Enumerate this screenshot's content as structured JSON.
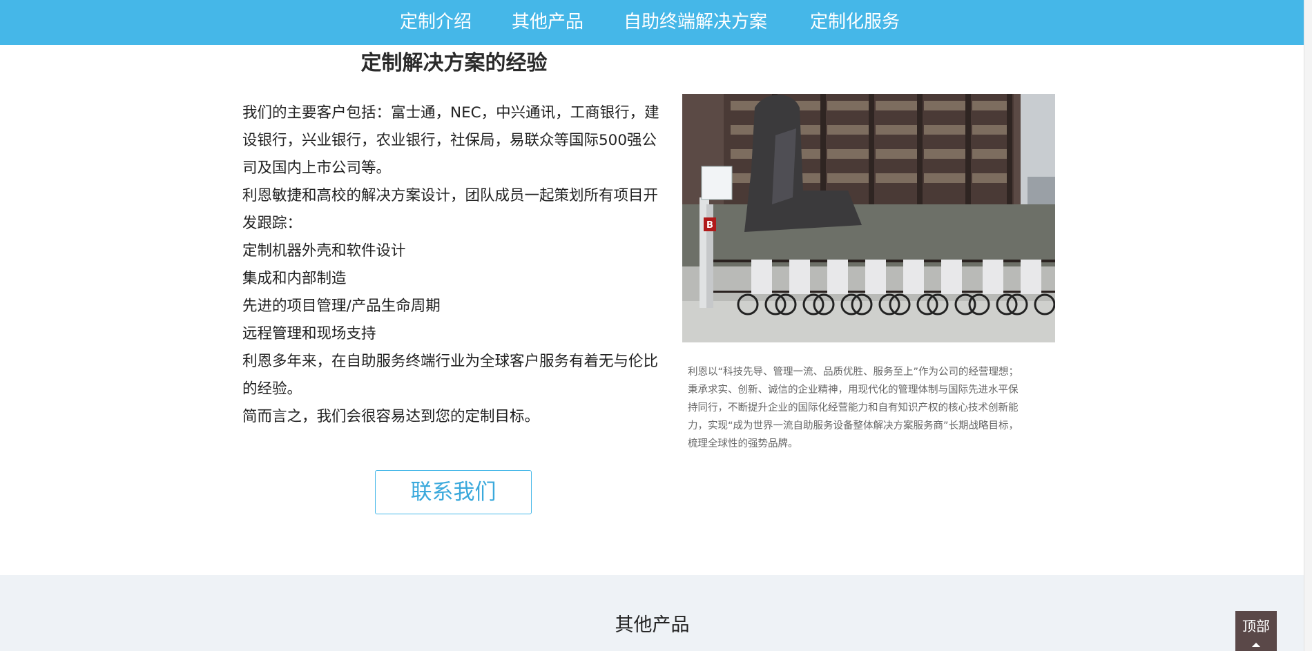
{
  "nav": {
    "items": [
      {
        "label": "定制介绍"
      },
      {
        "label": "其他产品"
      },
      {
        "label": "自助终端解决方案"
      },
      {
        "label": "定制化服务"
      }
    ]
  },
  "main": {
    "title": "定制解决方案的经验",
    "paragraphs": [
      "我们的主要客户包括：富士通，NEC，中兴通讯，工商银行，建设银行，兴业银行，农业银行，社保局，易联众等国际500强公司及国内上市公司等。",
      "利恩敏捷和高校的解决方案设计，团队成员一起策划所有项目开发跟踪：",
      "定制机器外壳和软件设计",
      "集成和内部制造",
      "先进的项目管理/产品生命周期",
      "远程管理和现场支持",
      "利恩多年来，在自助服务终端行业为全球客户服务有着无与伦比的经验。",
      "简而言之，我们会很容易达到您的定制目标。"
    ],
    "contact_button": "联系我们",
    "photo_sign_letter": "B",
    "caption": "利恩以“科技先导、管理一流、品质优胜、服务至上”作为公司的经营理想；秉承求实、创新、诚信的企业精神，用现代化的管理体制与国际先进水平保持同行，不断提升企业的国际化经营能力和自有知识产权的核心技术创新能力，实现“成为世界一流自助服务设备整体解决方案服务商”长期战略目标，梳理全球性的强势品牌。"
  },
  "products": {
    "title": "其他产品"
  },
  "back_to_top": {
    "label": "顶部"
  },
  "colors": {
    "nav_bg": "#45b7e8",
    "accent": "#3aa9dc",
    "band_bg": "#eef2f6",
    "back_top_bg": "#5a4848"
  }
}
